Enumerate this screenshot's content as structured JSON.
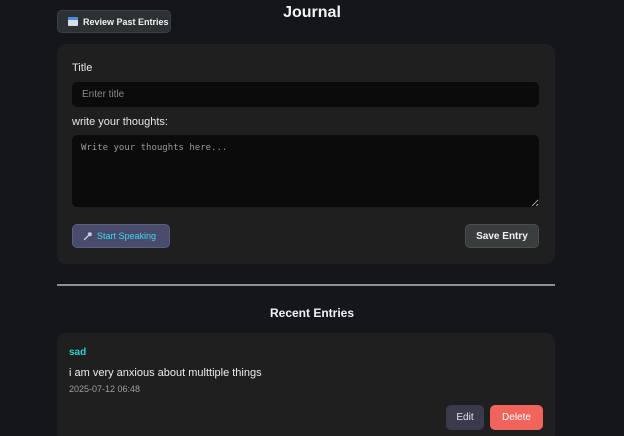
{
  "header": {
    "title": "Journal",
    "review_button_label": "Review Past Entries"
  },
  "form": {
    "title_label": "Title",
    "title_placeholder": "Enter title",
    "thoughts_label": "write your thoughts:",
    "thoughts_placeholder": "Write your thoughts here...",
    "speak_button_label": "Start Speaking",
    "save_button_label": "Save Entry"
  },
  "recent": {
    "heading": "Recent Entries",
    "entries": [
      {
        "title": "sad",
        "body": "i am very anxious about multtiple things",
        "timestamp": "2025-07-12 06:48",
        "edit_label": "Edit",
        "delete_label": "Delete"
      }
    ]
  },
  "colors": {
    "background": "#15161c",
    "card": "#1f1f20",
    "accent_teal": "#2ad2c8",
    "speak_text": "#3fd6ef",
    "delete": "#f0645c"
  },
  "icons": {
    "review_button": "calendar-icon",
    "speak_button": "microphone-icon"
  }
}
